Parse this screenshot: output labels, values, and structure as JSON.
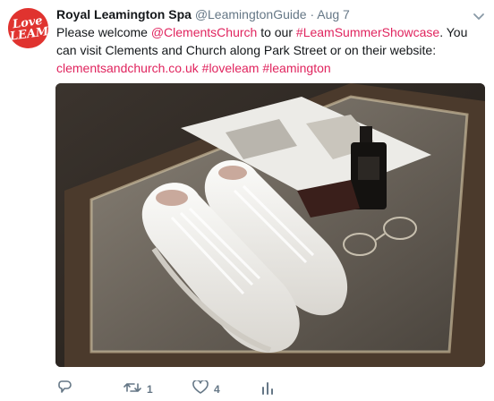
{
  "tweet": {
    "avatar_text": "Love LEAM",
    "display_name": "Royal Leamington Spa",
    "handle": "@LeamingtonGuide",
    "separator": "·",
    "date": "Aug 7",
    "text_1": "Please welcome ",
    "mention": "@ClementsChurch",
    "text_2": " to our ",
    "hashtag_1": "#LeamSummerShowcase",
    "text_3": ". You can visit Clements and Church along Park Street or on their website: ",
    "url": "clementsandchurch.co.uk",
    "space": " ",
    "hashtag_2": "#loveleam",
    "hashtag_3": "#leamington",
    "media_alt": "White leather sneakers on a glass display table with a magazine, cologne bottle, wallet and glasses"
  },
  "actions": {
    "reply_icon": "reply-icon",
    "retweet_icon": "retweet-icon",
    "retweet_count": "1",
    "like_icon": "heart-icon",
    "like_count": "4",
    "analytics_icon": "analytics-icon"
  },
  "colors": {
    "link": "#e0245e",
    "meta": "#657786",
    "avatar_bg": "#e0332f"
  }
}
